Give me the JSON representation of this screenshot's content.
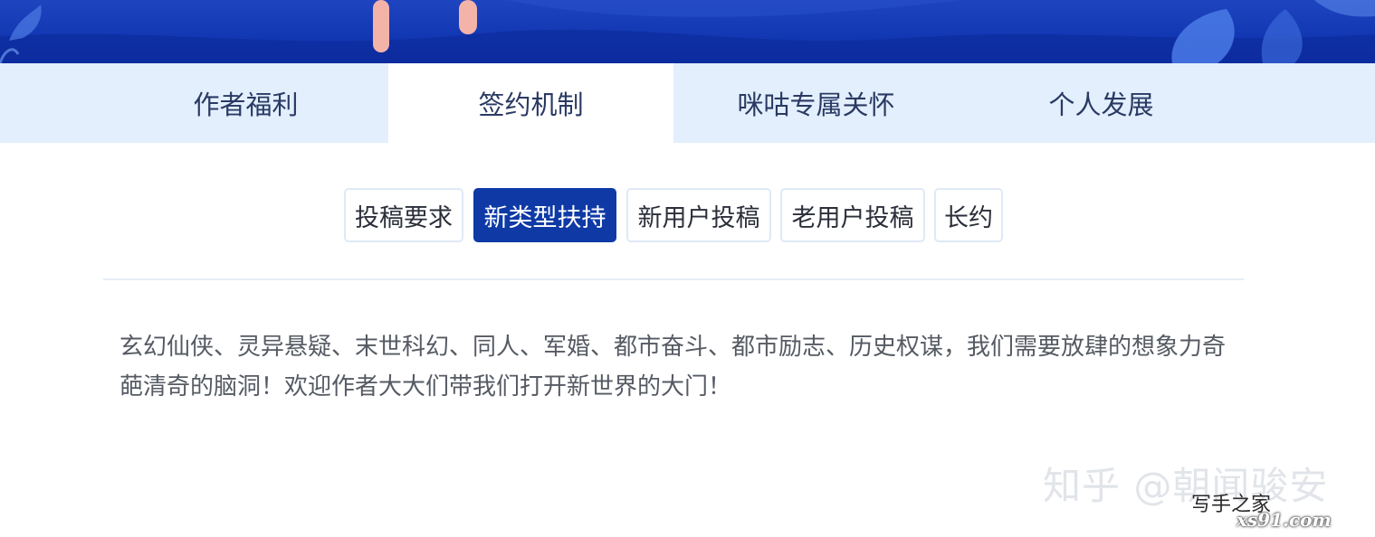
{
  "main_tabs": [
    {
      "label": "作者福利"
    },
    {
      "label": "签约机制"
    },
    {
      "label": "咪咕专属关怀"
    },
    {
      "label": "个人发展"
    }
  ],
  "active_main_tab": "签约机制",
  "sub_tabs": [
    {
      "label": "投稿要求"
    },
    {
      "label": "新类型扶持"
    },
    {
      "label": "新用户投稿"
    },
    {
      "label": "老用户投稿"
    },
    {
      "label": "长约"
    }
  ],
  "active_sub_tab": "新类型扶持",
  "content": {
    "text": "玄幻仙侠、灵异悬疑、末世科幻、同人、军婚、都市奋斗、都市励志、历史权谋，我们需要放肆的想象力奇葩清奇的脑洞！欢迎作者大大们带我们打开新世界的大门！"
  },
  "watermarks": {
    "zhihu": "知乎 @朝闻骏安",
    "site": "写手之家",
    "domain": "xs91.com"
  },
  "colors": {
    "banner": "#1338b4",
    "tab_bar": "#e3effd",
    "accent": "#0f3aa6"
  }
}
